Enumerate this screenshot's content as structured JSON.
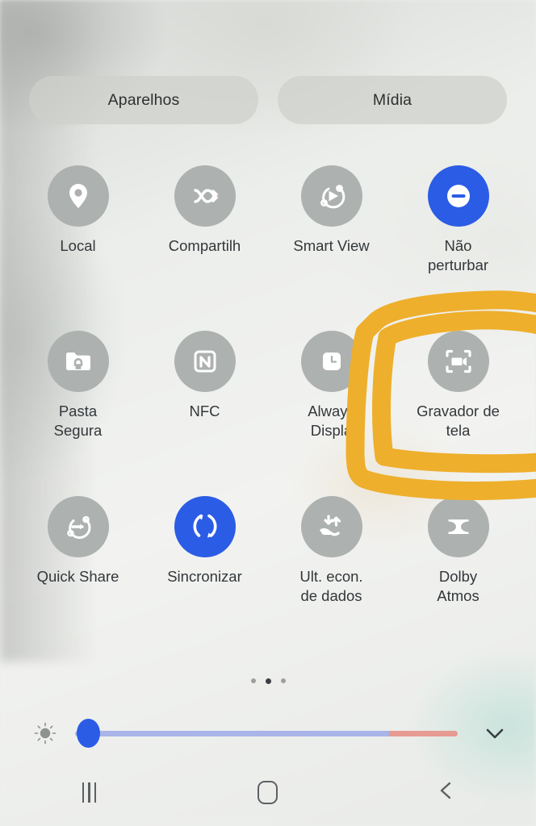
{
  "colors": {
    "accent_blue": "#2b5ce6",
    "inactive_gray": "#adb1af",
    "panel_bg": "#eceeec",
    "annotation_orange": "#eeaf2c",
    "slider_track": "#a9b4e8",
    "slider_warm": "#e79b92",
    "label_text": "#33373a"
  },
  "top_tabs": [
    {
      "label": "Aparelhos",
      "name": "tab-aparelhos"
    },
    {
      "label": "Mídia",
      "name": "tab-midia"
    }
  ],
  "toggles": [
    {
      "label": "Local",
      "icon": "location-pin-icon",
      "state": "off",
      "clipped": false
    },
    {
      "label": "Compartilh",
      "icon": "nearby-share-icon",
      "state": "off",
      "clipped": true
    },
    {
      "label": "Smart View",
      "icon": "smart-view-icon",
      "state": "off",
      "clipped": false
    },
    {
      "label": "Não\nperturbar",
      "icon": "do-not-disturb-icon",
      "state": "on",
      "clipped": false
    },
    {
      "label": "Pasta\nSegura",
      "icon": "secure-folder-icon",
      "state": "off",
      "clipped": false
    },
    {
      "label": "NFC",
      "icon": "nfc-icon",
      "state": "off",
      "clipped": false
    },
    {
      "label": "Always\nDispla",
      "icon": "clock-icon",
      "state": "off",
      "clipped": true
    },
    {
      "label": "Gravador de\ntela",
      "icon": "screen-recorder-icon",
      "state": "off",
      "clipped": false
    },
    {
      "label": "Quick Share",
      "icon": "quick-share-icon",
      "state": "off",
      "clipped": false
    },
    {
      "label": "Sincronizar",
      "icon": "sync-icon",
      "state": "on",
      "clipped": false
    },
    {
      "label": "Ult. econ.\nde dados",
      "icon": "data-saver-icon",
      "state": "off",
      "clipped": false
    },
    {
      "label": "Dolby\nAtmos",
      "icon": "dolby-atmos-icon",
      "state": "off",
      "clipped": false
    }
  ],
  "page_indicator": {
    "total": 3,
    "active_index": 1
  },
  "brightness": {
    "icon": "brightness-sun-icon",
    "value_percent": 4,
    "warm_zone_start_percent": 82,
    "collapse_icon": "chevron-down-icon"
  },
  "annotation": {
    "type": "handdrawn-rectangle-highlight",
    "color": "#eeaf2c",
    "targets_label": "Gravador de tela"
  },
  "navbar": [
    {
      "label": "Recentes",
      "icon": "recents-icon",
      "name": "nav-recents"
    },
    {
      "label": "Início",
      "icon": "home-icon",
      "name": "nav-home"
    },
    {
      "label": "Voltar",
      "icon": "back-icon",
      "name": "nav-back"
    }
  ]
}
